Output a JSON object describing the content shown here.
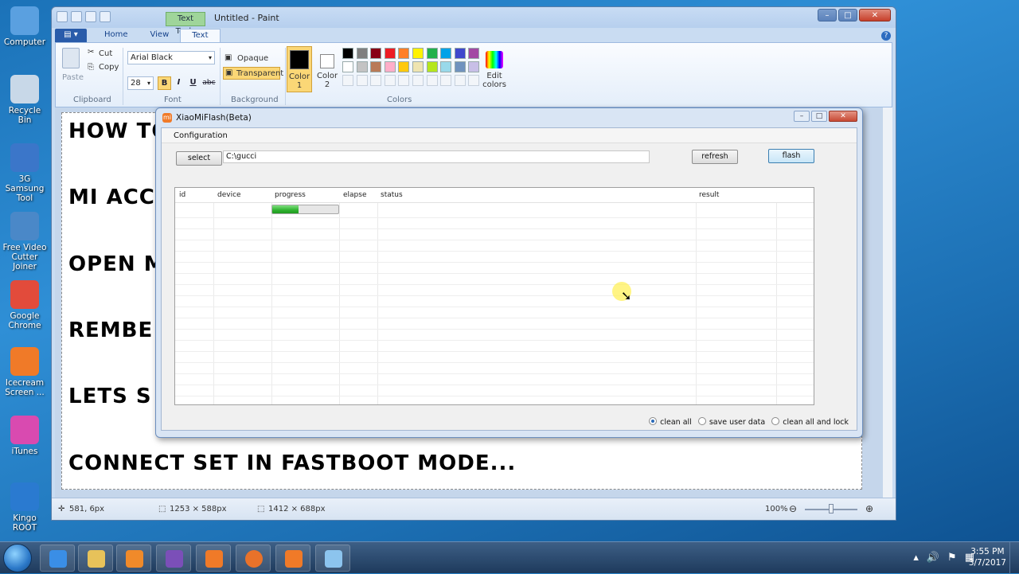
{
  "desktop": {
    "icons": [
      {
        "label": "Computer",
        "color": "#5aa0e0"
      },
      {
        "label": "Recycle Bin",
        "color": "#c8d8e8"
      },
      {
        "label": "3G Samsung Tool",
        "color": "#3b76c9"
      },
      {
        "label": "Free Video Cutter Joiner",
        "color": "#4a88c8"
      },
      {
        "label": "Google Chrome",
        "color": "#e24b3b"
      },
      {
        "label": "Icecream Screen ...",
        "color": "#f07a28"
      },
      {
        "label": "iTunes",
        "color": "#d94ab0"
      },
      {
        "label": "Kingo ROOT",
        "color": "#2a7ad0"
      }
    ]
  },
  "paint": {
    "context_tab": "Text Tools",
    "title": "Untitled - Paint",
    "tabs": [
      "Home",
      "View",
      "Text"
    ],
    "active_tab": "Text",
    "clipboard": {
      "paste": "Paste",
      "cut": "Cut",
      "copy": "Copy",
      "label": "Clipboard"
    },
    "font": {
      "family": "Arial Black",
      "size": "28",
      "label": "Font",
      "bold": "B",
      "italic": "I",
      "underline": "U",
      "strike": "abc"
    },
    "background": {
      "opaque": "Opaque",
      "transparent": "Transparent",
      "label": "Background"
    },
    "colors": {
      "color1": "Color 1",
      "color2": "Color 2",
      "edit": "Edit colors",
      "label": "Colors",
      "palette_row1": [
        "#000000",
        "#7f7f7f",
        "#880015",
        "#ed1c24",
        "#ff7f27",
        "#fff200",
        "#22b14c",
        "#00a2e8",
        "#3f48cc",
        "#a349a4"
      ],
      "palette_row2": [
        "#ffffff",
        "#c3c3c3",
        "#b97a57",
        "#ffaec9",
        "#ffc90e",
        "#efe4b0",
        "#b5e61d",
        "#99d9ea",
        "#7092be",
        "#c8bfe7"
      ]
    },
    "canvas_lines": [
      "HOW TO FLASH OR REMOVE MI CLOUD",
      "MI ACC",
      "OPEN M",
      "REMBE",
      "LETS S",
      "CONNECT SET IN FASTBOOT MODE..."
    ],
    "status": {
      "cursor": "581, 6px",
      "selection": "1253 × 588px",
      "size": "1412 × 688px",
      "zoom": "100%"
    }
  },
  "miflash": {
    "title": "XiaoMiFlash(Beta)",
    "menu": "Configuration",
    "select_label": "select",
    "path_value": "C:\\gucci",
    "refresh_label": "refresh",
    "flash_label": "flash",
    "columns": [
      "id",
      "device",
      "progress",
      "elapse",
      "status",
      "result"
    ],
    "progress_fraction": 0.4,
    "options": [
      "clean all",
      "save user data",
      "clean all and lock"
    ],
    "selected_option": "clean all"
  },
  "taskbar": {
    "time": "3:55 PM",
    "date": "3/7/2017"
  }
}
